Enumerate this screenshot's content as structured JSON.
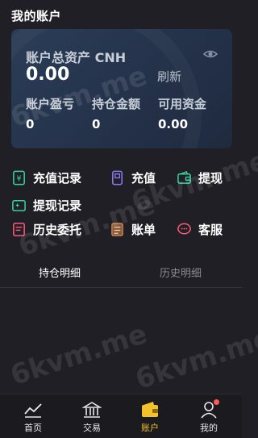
{
  "page_title": "我的账户",
  "asset_card": {
    "total_label": "账户总资产 CNH",
    "total_value": "0.00",
    "refresh_label": "刷新",
    "stats": [
      {
        "label": "账户盈亏",
        "value": "0"
      },
      {
        "label": "持仓金额",
        "value": "0"
      },
      {
        "label": "可用资金",
        "value": "0.00"
      }
    ]
  },
  "menu": {
    "recharge_records": "充值记录",
    "recharge": "充值",
    "withdraw": "提现",
    "withdraw_records": "提现记录",
    "history_orders": "历史委托",
    "bill": "账单",
    "customer_service": "客服"
  },
  "tabs": {
    "holdings": "持仓明细",
    "history": "历史明细"
  },
  "bottom_nav": {
    "home": "首页",
    "trade": "交易",
    "account": "账户",
    "mine": "我的"
  },
  "watermark": "6kvm.me",
  "colors": {
    "background": "#1f1f25",
    "card": "#2b3d57",
    "accent_yellow": "#f3c12a",
    "accent_green": "#3ad29f",
    "accent_purple": "#8a7cf0",
    "accent_red": "#ff5a7a"
  }
}
